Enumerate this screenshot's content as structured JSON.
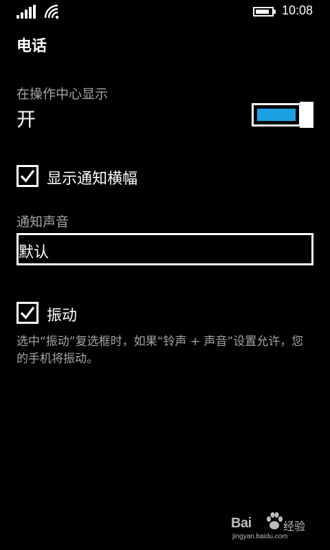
{
  "status_bar": {
    "signal_icon": "signal-strength-icon",
    "wifi_icon": "wifi-icon",
    "battery_icon": "battery-icon",
    "time": "10:08"
  },
  "page": {
    "title": "电话"
  },
  "action_center": {
    "label": "在操作中心显示",
    "state_text": "开",
    "toggle_on": true,
    "accent_color": "#1ba1e2"
  },
  "show_banner": {
    "label": "显示通知横幅",
    "checked": true
  },
  "notification_sound": {
    "label": "通知声音",
    "value": "默认"
  },
  "vibrate": {
    "label": "振动",
    "checked": true,
    "help_text": "选中“振动”复选框时，如果“铃声 + 声音”设置允许，您的手机将振动。"
  },
  "watermark": {
    "brand": "Bai",
    "brand_suffix": "经验",
    "url": "jingyan.baidu.com"
  }
}
